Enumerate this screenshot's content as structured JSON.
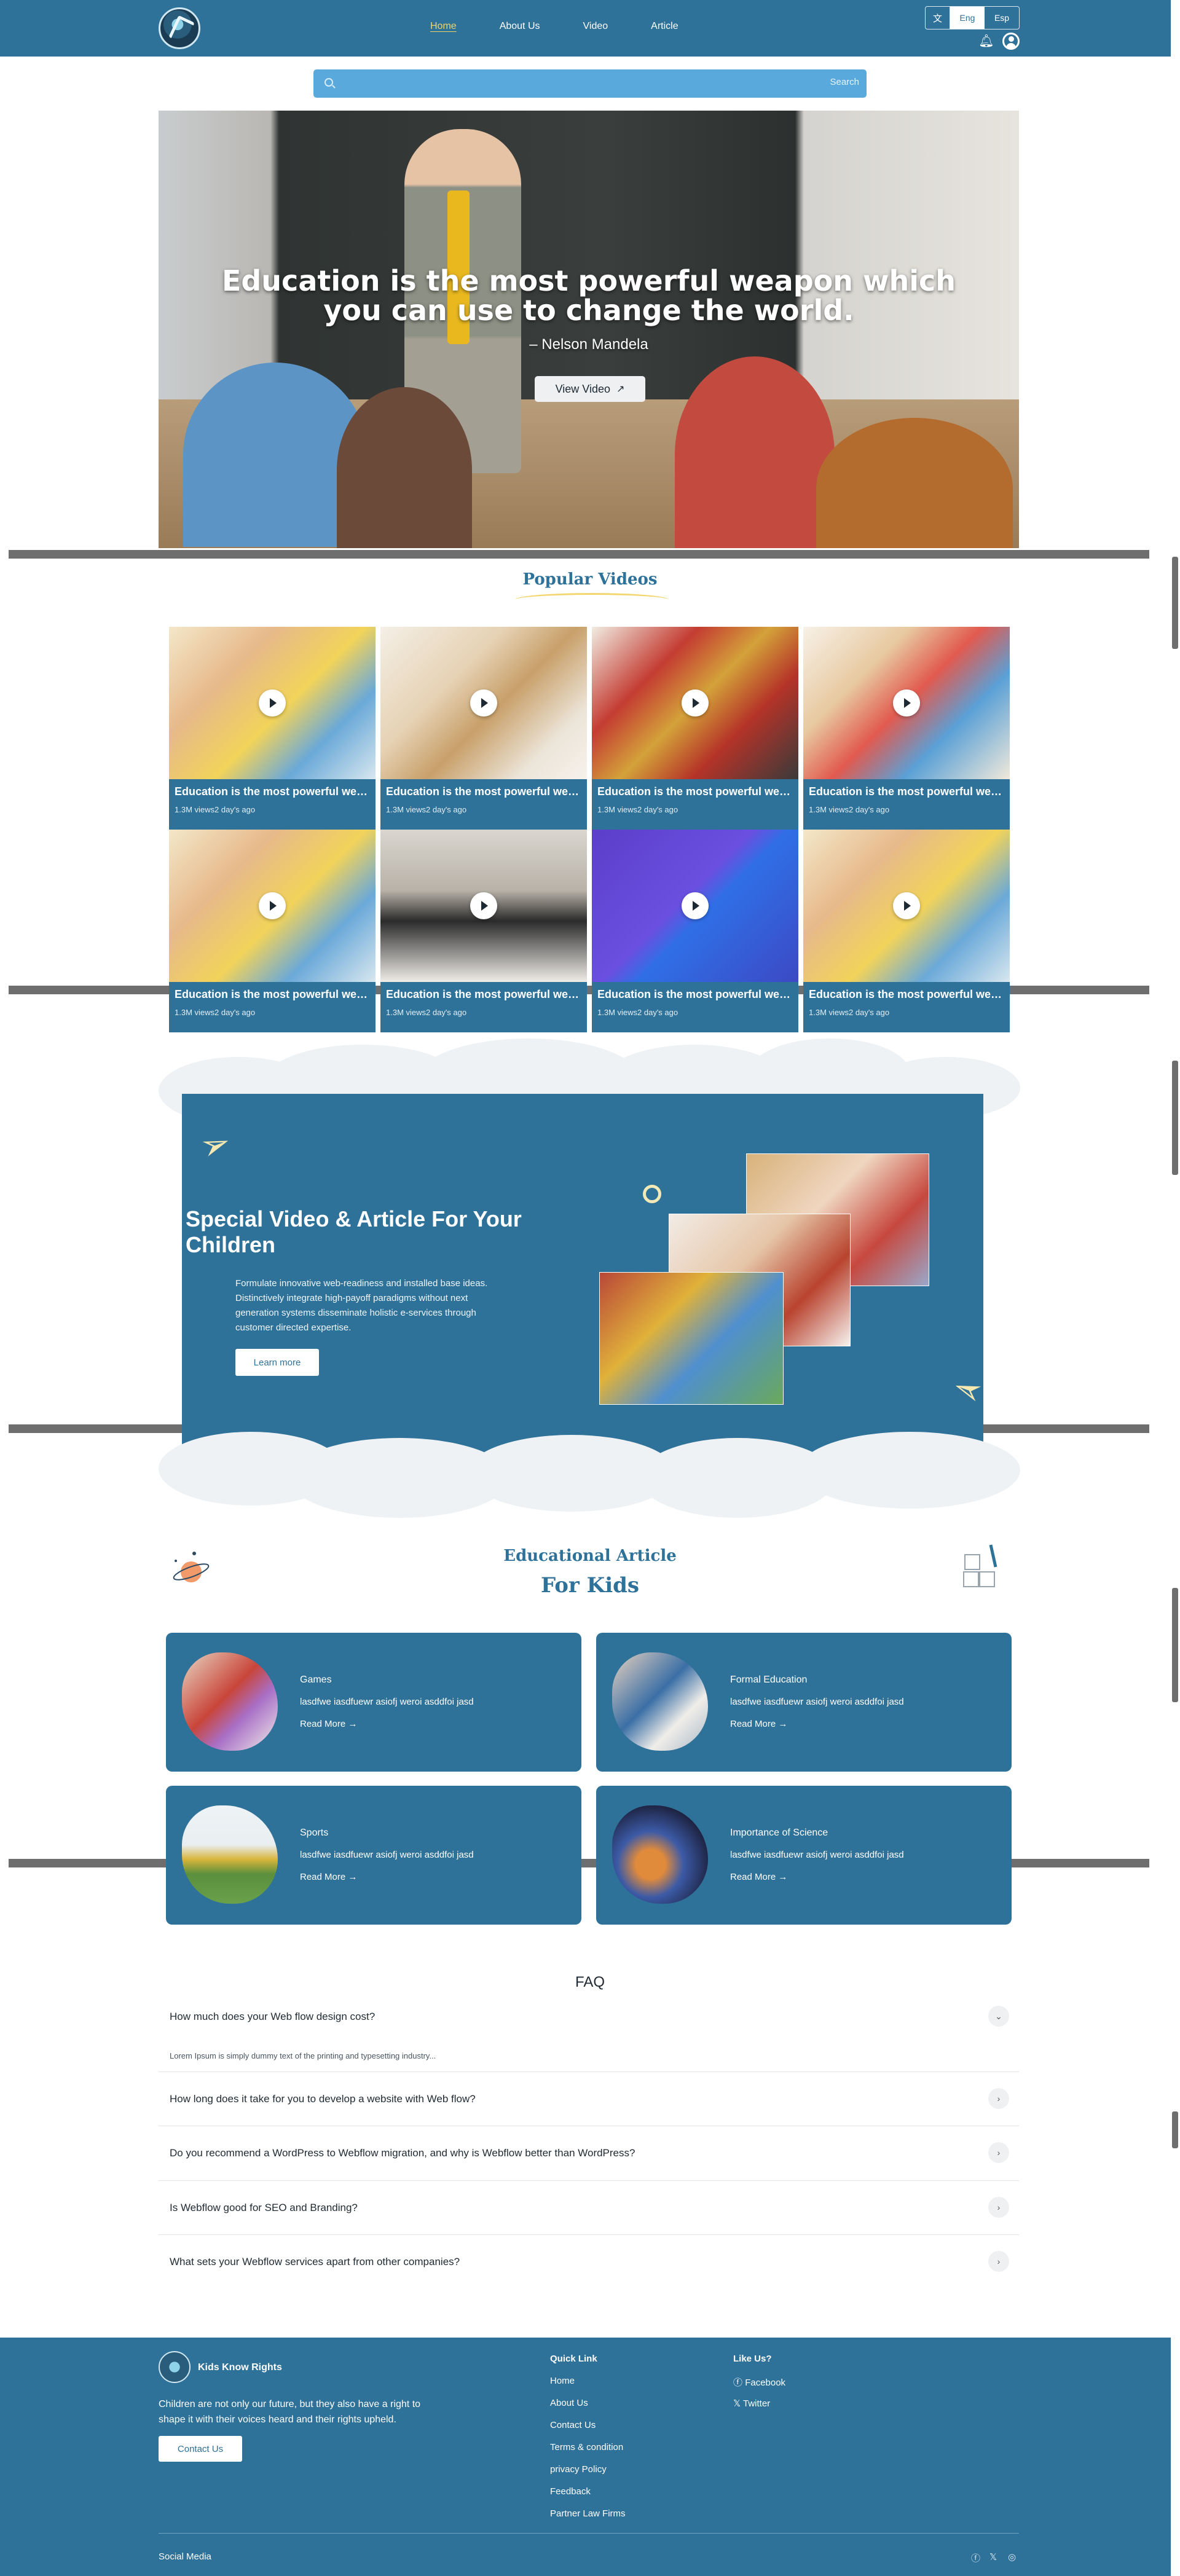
{
  "header": {
    "nav": [
      {
        "label": "Home",
        "active": true
      },
      {
        "label": "About Us",
        "active": false
      },
      {
        "label": "Video",
        "active": false
      },
      {
        "label": "Article",
        "active": false
      }
    ],
    "languages": [
      "Eng",
      "Esp"
    ],
    "selected_language": "Eng"
  },
  "search": {
    "placeholder": "",
    "button": "Search"
  },
  "hero": {
    "quote": "Education is the most powerful weapon which you can use to change the world.",
    "author": "– Nelson Mandela",
    "button": "View Video"
  },
  "popular": {
    "title": "Popular Videos",
    "videos": [
      {
        "title": "Education is the most powerful weapon which you",
        "meta": "1.3M views2 day's ago"
      },
      {
        "title": "Education is the most powerful weapon which you",
        "meta": "1.3M views2 day's ago"
      },
      {
        "title": "Education is the most powerful weapon which you",
        "meta": "1.3M views2 day's ago"
      },
      {
        "title": "Education is the most powerful weapon which you",
        "meta": "1.3M views2 day's ago"
      },
      {
        "title": "Education is the most powerful weapon which you",
        "meta": "1.3M views2 day's ago"
      },
      {
        "title": "Education is the most powerful weapon which you",
        "meta": "1.3M views2 day's ago"
      },
      {
        "title": "Education is the most powerful weapon which you",
        "meta": "1.3M views2 day's ago"
      },
      {
        "title": "Education is the most powerful weapon which you",
        "meta": "1.3M views2 day's ago"
      }
    ]
  },
  "special": {
    "title": "Special Video & Article For Your Children",
    "body": "Formulate innovative web-readiness and installed base ideas. Distinctively integrate high-payoff paradigms without next generation systems disseminate holistic e-services through customer directed expertise.",
    "button": "Learn more"
  },
  "articles": {
    "subtitle": "Educational Article",
    "title": "For Kids",
    "items": [
      {
        "category": "Games",
        "desc": "lasdfwe iasdfuewr asiofj weroi asddfoi jasd",
        "link": "Read More"
      },
      {
        "category": "Formal Education",
        "desc": "lasdfwe iasdfuewr asiofj weroi asddfoi jasd",
        "link": "Read More"
      },
      {
        "category": "Sports",
        "desc": "lasdfwe iasdfuewr asiofj weroi asddfoi jasd",
        "link": "Read More"
      },
      {
        "category": "Importance of Science",
        "desc": "lasdfwe iasdfuewr asiofj weroi asddfoi jasd",
        "link": "Read More"
      }
    ]
  },
  "faq": {
    "title": "FAQ",
    "items": [
      {
        "q": "How much does your Web flow design cost?",
        "a": "Lorem Ipsum is simply dummy text of the printing and typesetting industry...",
        "open": true
      },
      {
        "q": "How long does it take for you to develop a website with Web flow?",
        "a": "",
        "open": false
      },
      {
        "q": "Do you recommend a WordPress to Webflow migration, and why is Webflow better than WordPress?",
        "a": "",
        "open": false
      },
      {
        "q": "Is Webflow good for SEO and Branding?",
        "a": "",
        "open": false
      },
      {
        "q": "What sets your Webflow services apart from other companies?",
        "a": "",
        "open": false
      }
    ]
  },
  "footer": {
    "brand": "Kids Know Rights",
    "description": "Children are not only our future, but they also have a right to shape it with their voices heard and their rights upheld.",
    "contact": "Contact Us",
    "quick_link_title": "Quick Link",
    "quick_links": [
      "Home",
      "About Us",
      "Contact Us",
      "Terms & condition",
      "privacy Policy",
      "Feedback",
      "Partner Law Firms"
    ],
    "like_title": "Like Us?",
    "like_links": [
      "Facebook",
      "Twitter"
    ],
    "social_label": "Social Media",
    "social_icons": [
      "facebook-icon",
      "x-twitter-icon",
      "instagram-icon"
    ]
  },
  "colors": {
    "primary": "#2e7199",
    "accent": "#f2d46a",
    "search": "#5aa9dc"
  }
}
